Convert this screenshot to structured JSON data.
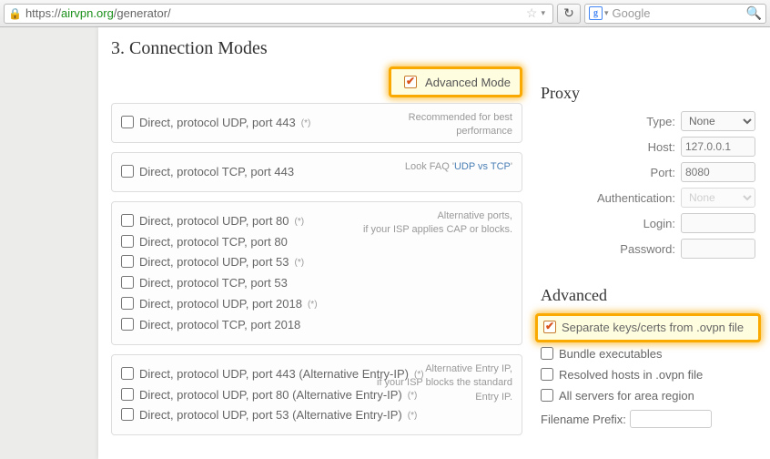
{
  "browser": {
    "url_prefix": "https://",
    "url_host": "airvpn.org",
    "url_path": "/generator/",
    "search_placeholder": "Google"
  },
  "section_title": "3. Connection Modes",
  "adv_mode_label": "Advanced Mode",
  "blocks": [
    {
      "hint_lines": [
        "Recommended for best performance"
      ],
      "rows": [
        {
          "label": "Direct, protocol UDP, port 443",
          "sup": "(*)",
          "checked": false
        }
      ]
    },
    {
      "hint_lines": [
        "Look FAQ '",
        {
          "link": "UDP vs TCP"
        },
        "'"
      ],
      "rows": [
        {
          "label": "Direct, protocol TCP, port 443",
          "sup": "",
          "checked": false
        }
      ]
    },
    {
      "hint_lines": [
        "Alternative ports,",
        "if your ISP applies CAP or blocks."
      ],
      "rows": [
        {
          "label": "Direct, protocol UDP, port 80",
          "sup": "(*)",
          "checked": false
        },
        {
          "label": "Direct, protocol TCP, port 80",
          "sup": "",
          "checked": false
        },
        {
          "label": "Direct, protocol UDP, port 53",
          "sup": "(*)",
          "checked": false
        },
        {
          "label": "Direct, protocol TCP, port 53",
          "sup": "",
          "checked": false
        },
        {
          "label": "Direct, protocol UDP, port 2018",
          "sup": "(*)",
          "checked": false
        },
        {
          "label": "Direct, protocol TCP, port 2018",
          "sup": "",
          "checked": false
        }
      ]
    },
    {
      "hint_lines": [
        "Alternative Entry IP,",
        "if your ISP blocks the standard Entry IP."
      ],
      "rows": [
        {
          "label": "Direct, protocol UDP, port 443 (Alternative Entry-IP)",
          "sup": "(*)",
          "checked": false
        },
        {
          "label": "Direct, protocol UDP, port 80 (Alternative Entry-IP)",
          "sup": "(*)",
          "checked": false
        },
        {
          "label": "Direct, protocol UDP, port 53 (Alternative Entry-IP)",
          "sup": "(*)",
          "checked": false
        }
      ]
    }
  ],
  "proxy": {
    "title": "Proxy",
    "type_label": "Type:",
    "type_value": "None",
    "host_label": "Host:",
    "host_placeholder": "127.0.0.1",
    "port_label": "Port:",
    "port_placeholder": "8080",
    "auth_label": "Authentication:",
    "auth_value": "None",
    "login_label": "Login:",
    "password_label": "Password:"
  },
  "advanced": {
    "title": "Advanced",
    "items": [
      {
        "label": "Separate keys/certs from .ovpn file",
        "checked": true,
        "highlight": true
      },
      {
        "label": "Bundle executables",
        "checked": false
      },
      {
        "label": "Resolved hosts in .ovpn file",
        "checked": false
      },
      {
        "label": "All servers for area region",
        "checked": false
      }
    ],
    "filename_label": "Filename Prefix:"
  }
}
